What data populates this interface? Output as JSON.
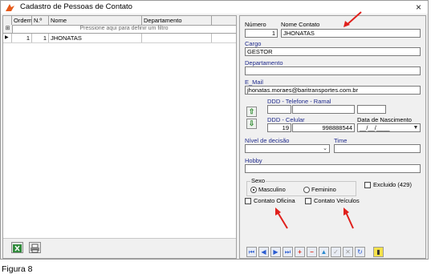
{
  "window": {
    "title": "Cadastro de Pessoas de Contato",
    "close_icon": "×"
  },
  "grid": {
    "columns": [
      "Ordem",
      "N.º",
      "Nome",
      "Departamento"
    ],
    "filter_placeholder": "Pressione aqui para definir um filtro",
    "rows": [
      {
        "ordem": "1",
        "numero": "1",
        "nome": "JHONATAS",
        "departamento": ""
      }
    ]
  },
  "form": {
    "numero_label": "Número",
    "numero_value": "1",
    "nome_label": "Nome Contato",
    "nome_value": "JHONATAS",
    "cargo_label": "Cargo",
    "cargo_value": "GESTOR",
    "departamento_label": "Departamento",
    "departamento_value": "",
    "email_label": "E_Mail",
    "email_value": "jhonatas.moraes@baritransportes.com.br",
    "telefone_label": "DDD - Telefone - Ramal",
    "celular_label": "DDD - Celular",
    "celular_ddd": "19",
    "celular_numero": "998888544",
    "nascimento_label": "Data de Nascimento",
    "nascimento_value": "__/__/____",
    "nivel_label": "Nível de decisão",
    "time_label": "Time",
    "hobby_label": "Hobby",
    "sexo_label": "Sexo",
    "sexo_masculino": "Masculino",
    "sexo_feminino": "Feminino",
    "excluido_label": "Excluido (429)",
    "contato_oficina_label": "Contato Oficina",
    "contato_veiculos_label": "Contato Veículos"
  },
  "caption": "Figura 8",
  "colors": {
    "label_blue": "#1f2a8c",
    "annotation_red": "#e0201c"
  }
}
